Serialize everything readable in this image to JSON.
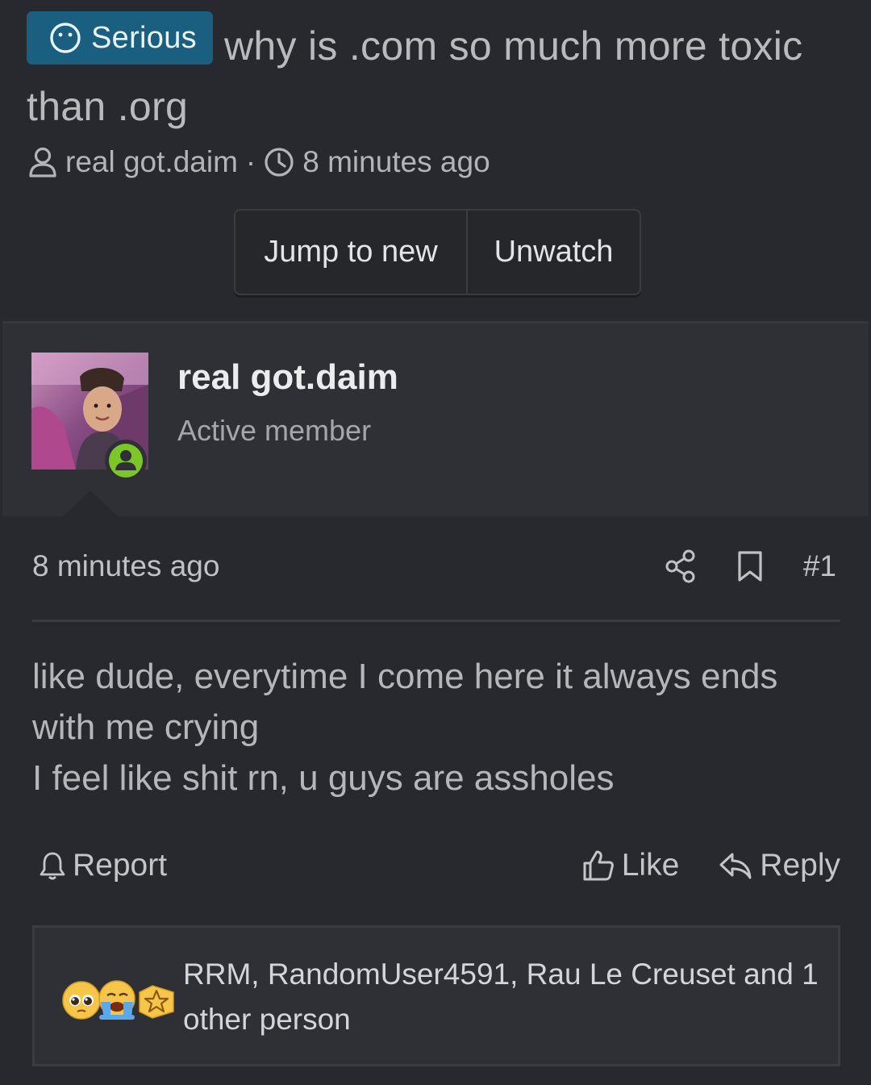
{
  "thread": {
    "prefix": "Serious",
    "title": "why is .com so much more toxic than .org",
    "author": "real got.daim",
    "separator": "·",
    "time": "8 minutes ago",
    "buttons": {
      "jump": "Jump to new",
      "unwatch": "Unwatch"
    }
  },
  "user": {
    "name": "real got.daim",
    "title": "Active member",
    "online": true
  },
  "post": {
    "time": "8 minutes ago",
    "number": "#1",
    "lines": [
      "like dude, everytime I come here it always ends with me crying",
      "I feel like shit rn, u guys are assholes"
    ],
    "actions": {
      "report": "Report",
      "like": "Like",
      "reply": "Reply"
    },
    "reactions": {
      "icons": [
        "pleading-face",
        "loudly-crying-face",
        "star-badge"
      ],
      "text": "RRM, RandomUser4591, Rau Le Creuset and 1 other person"
    }
  },
  "colors": {
    "background": "#27292e",
    "panel": "#2e3036",
    "badge": "#1b5f80",
    "online": "#7cc628"
  }
}
